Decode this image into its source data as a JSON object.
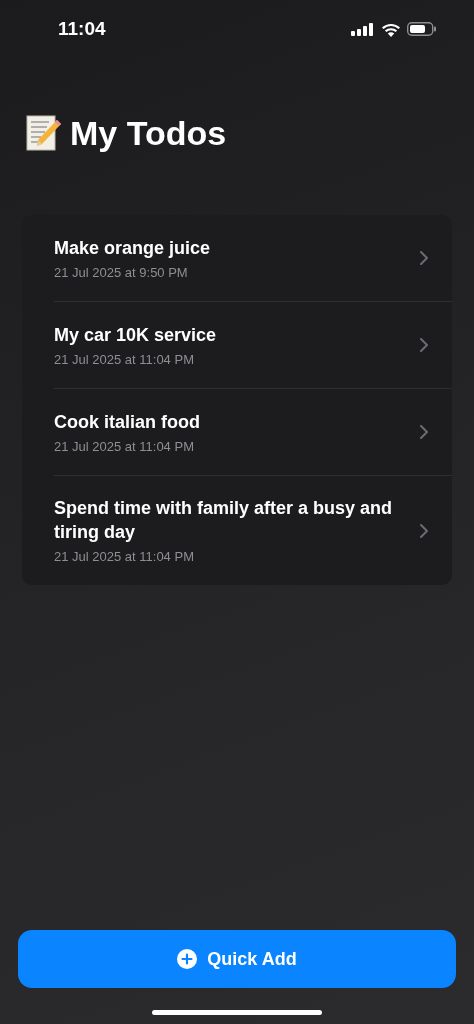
{
  "status_bar": {
    "time": "11:04"
  },
  "title": "My Todos",
  "todos": [
    {
      "title": "Make orange juice",
      "date": "21 Jul 2025 at 9:50 PM"
    },
    {
      "title": "My car 10K service",
      "date": "21 Jul 2025 at 11:04 PM"
    },
    {
      "title": "Cook italian food",
      "date": "21 Jul 2025 at 11:04 PM"
    },
    {
      "title": "Spend time with family after a busy and tiring day",
      "date": "21 Jul 2025 at 11:04 PM"
    }
  ],
  "quick_add_button": {
    "label": "Quick Add"
  }
}
